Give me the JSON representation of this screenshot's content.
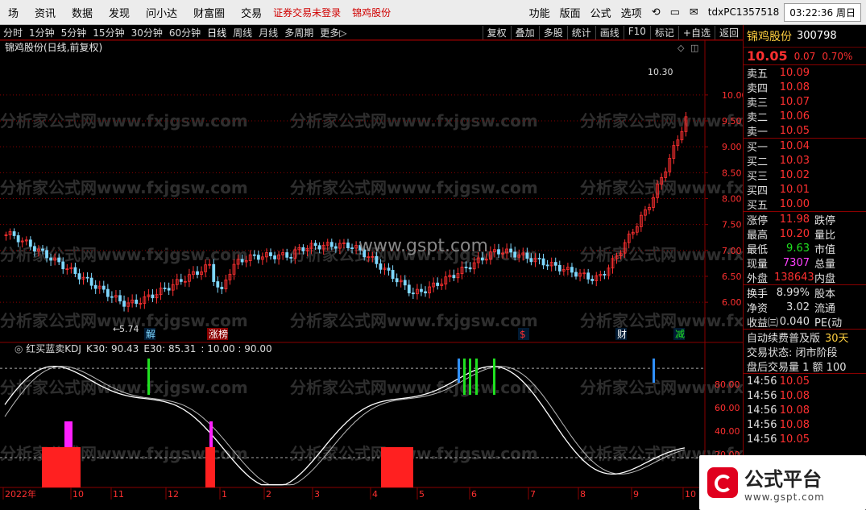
{
  "menu": {
    "items": [
      "场",
      "资讯",
      "数据",
      "发现",
      "问小达",
      "财富圈",
      "交易"
    ],
    "warning": "证券交易未登录",
    "stock_link": "锦鸡股份",
    "right_items": [
      "功能",
      "版面",
      "公式",
      "选项"
    ],
    "account": "tdxPC1357518",
    "clock": "03:22:36 周日"
  },
  "toolbar": {
    "periods": [
      "分时",
      "1分钟",
      "5分钟",
      "15分钟",
      "30分钟",
      "60分钟",
      "日线",
      "周线",
      "月线",
      "多周期",
      "更多▷"
    ],
    "active": "日线",
    "right": [
      "复权",
      "叠加",
      "多股",
      "统计",
      "画线",
      "F10",
      "标记",
      "+自选",
      "返回"
    ]
  },
  "chart": {
    "title": "锦鸡股份(日线,前复权)",
    "high_label": "10.30",
    "low_label": "5.74",
    "price_ticks": [
      "10.00",
      "9.50",
      "9.00",
      "8.50",
      "8.00",
      "7.50",
      "7.00",
      "6.50",
      "6.00"
    ],
    "markers": [
      "解",
      "涨榜",
      "$",
      "财",
      "减"
    ],
    "watermark_site": "www.gspt.com",
    "watermark_text": "分析家公式网www.fxjgsw.com"
  },
  "indicator": {
    "title": "红买蓝卖KDJ",
    "k_label": "K30: 90.43",
    "e_label": "E30: 85.31",
    "extra": ": 10.00 : 90.00",
    "ticks": [
      "80.00",
      "60.00",
      "40.00",
      "20.00"
    ]
  },
  "xaxis": [
    "2022年",
    "10",
    "11",
    "12",
    "1",
    "2",
    "3",
    "4",
    "5",
    "6",
    "7",
    "8",
    "9",
    "10"
  ],
  "quote": {
    "name": "锦鸡股份",
    "code": "300798",
    "price": "10.05",
    "change": "0.07",
    "pct": "0.70%",
    "asks": [
      {
        "l": "卖五",
        "v": "10.09"
      },
      {
        "l": "卖四",
        "v": "10.08"
      },
      {
        "l": "卖三",
        "v": "10.07"
      },
      {
        "l": "卖二",
        "v": "10.06"
      },
      {
        "l": "卖一",
        "v": "10.05"
      }
    ],
    "bids": [
      {
        "l": "买一",
        "v": "10.04"
      },
      {
        "l": "买二",
        "v": "10.03"
      },
      {
        "l": "买三",
        "v": "10.02"
      },
      {
        "l": "买四",
        "v": "10.01"
      },
      {
        "l": "买五",
        "v": "10.00"
      }
    ],
    "stats": [
      {
        "l": "涨停",
        "v": "11.98",
        "r": "跌停"
      },
      {
        "l": "最高",
        "v": "10.20",
        "r": "量比"
      },
      {
        "l": "最低",
        "v": "9.63",
        "r": "市值"
      },
      {
        "l": "现量",
        "v": "7307",
        "r": "总量"
      },
      {
        "l": "外盘",
        "v": "138643",
        "r": "内盘"
      }
    ],
    "stats2": [
      {
        "l": "换手",
        "v": "8.99%",
        "r": "股本"
      },
      {
        "l": "净资",
        "v": "3.02",
        "r": "流通"
      },
      {
        "l": "收益㈢",
        "v": "0.040",
        "r": "PE(动"
      }
    ],
    "notice1": "自动续费普及版",
    "notice1_tag": "30天",
    "notice2": "交易状态: 闭市阶段",
    "notice3": "盘后交易量 1 额 100",
    "ticks": [
      {
        "t": "14:56",
        "v": "10.05"
      },
      {
        "t": "14:56",
        "v": "10.08"
      },
      {
        "t": "14:56",
        "v": "10.08"
      },
      {
        "t": "14:56",
        "v": "10.08"
      },
      {
        "t": "14:56",
        "v": "10.05"
      }
    ]
  },
  "logo": {
    "name": "公式平台",
    "url": "www.gspt.com"
  },
  "colors": {
    "up": "#ff3030",
    "down": "#7fd8ff",
    "grid": "#8a0000",
    "kline": "#ffffff",
    "buy": "#ff2020",
    "sell": "#ff20ff",
    "green": "#20e020",
    "blue": "#3090ff"
  }
}
